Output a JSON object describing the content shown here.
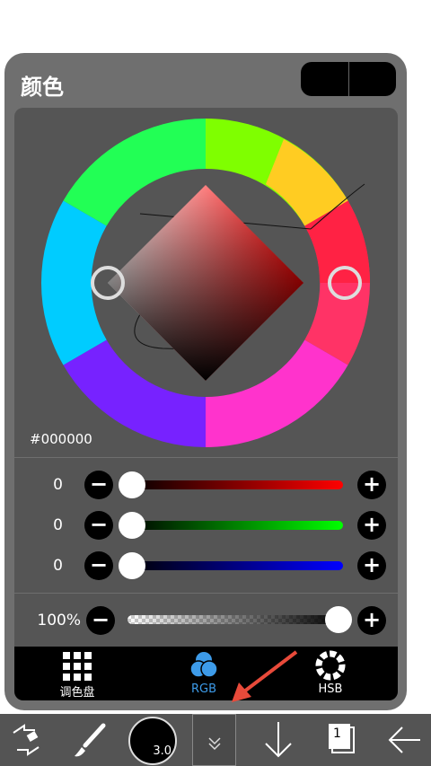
{
  "panel": {
    "title": "颜色"
  },
  "hex": "#000000",
  "sliders": [
    {
      "name": "red",
      "value": "0",
      "color": "#ff0000"
    },
    {
      "name": "green",
      "value": "0",
      "color": "#00ff00"
    },
    {
      "name": "blue",
      "value": "0",
      "color": "#0000ff"
    }
  ],
  "opacity": {
    "value": "100%"
  },
  "tabs": [
    {
      "label": "调色盘",
      "icon": "grid-icon"
    },
    {
      "label": "RGB",
      "icon": "rgb-circles-icon",
      "active_color": "#3d9be9"
    },
    {
      "label": "HSB",
      "icon": "hsb-ring-icon"
    }
  ],
  "toolbar": {
    "brush_size": "3.0",
    "layer_number": "1"
  },
  "colors": {
    "accent": "#3d9be9",
    "arrow": "#e84a3a"
  }
}
